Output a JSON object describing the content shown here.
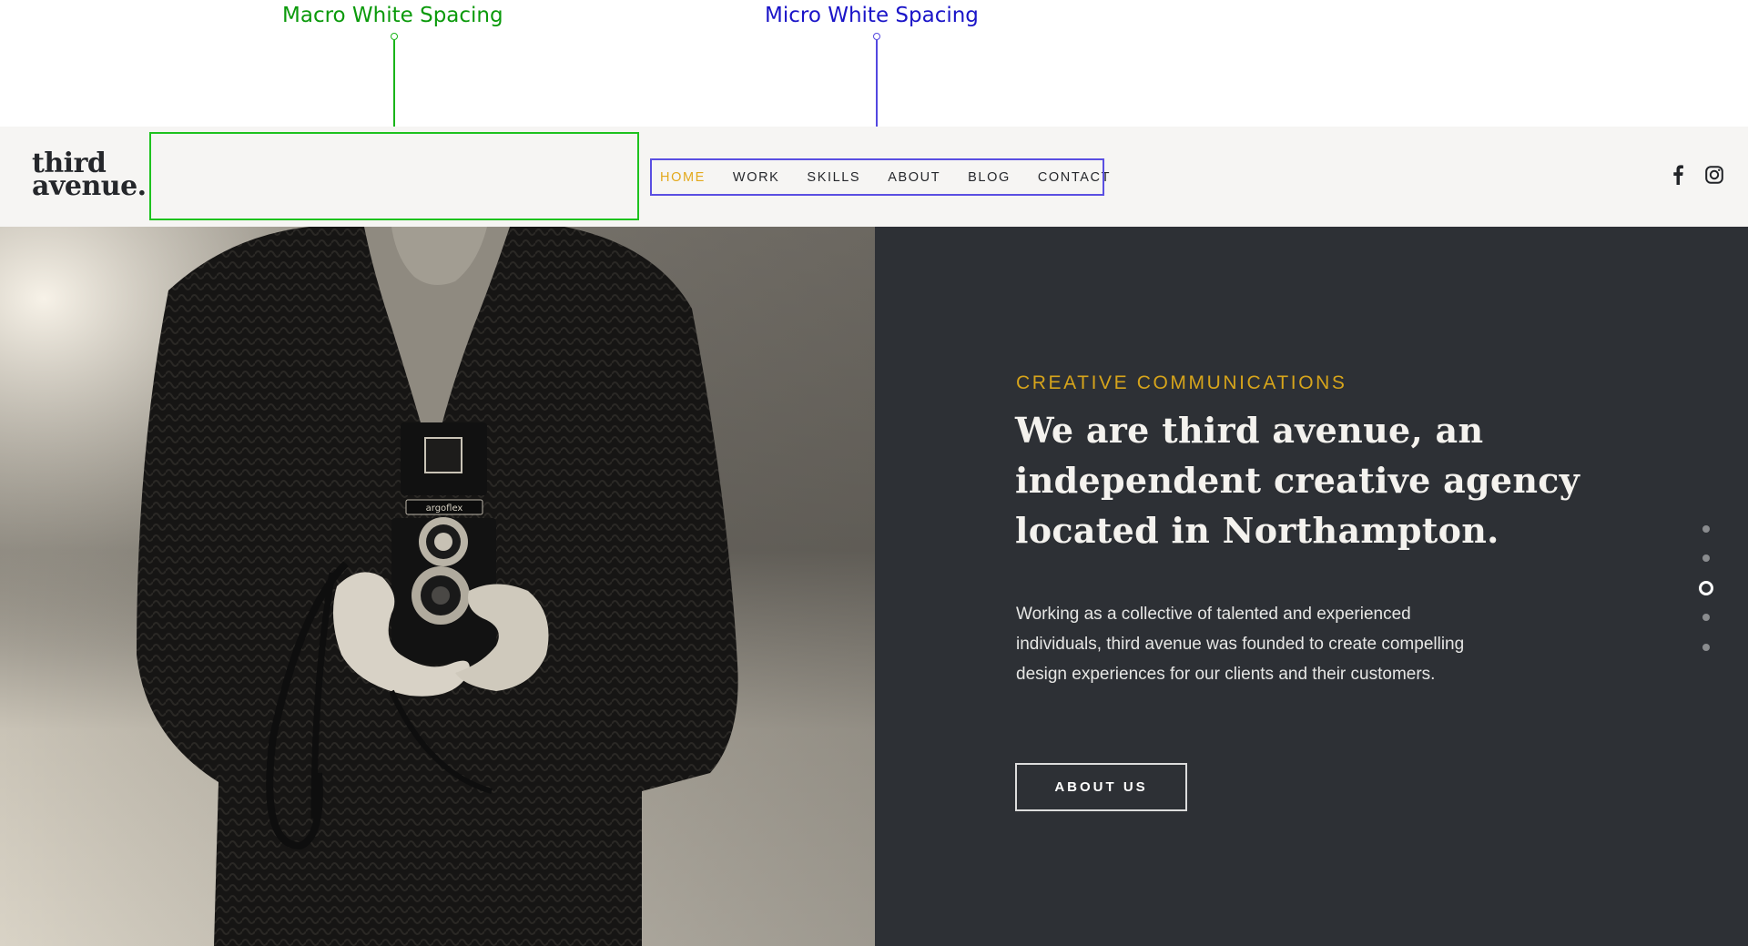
{
  "annotations": {
    "macro_label": "Macro White Spacing",
    "micro_label": "Micro White Spacing",
    "macro_color": "#0b9a0b",
    "micro_color": "#1a14c8"
  },
  "header": {
    "logo_line1": "third",
    "logo_line2": "avenue.",
    "nav": [
      {
        "label": "HOME",
        "active": true
      },
      {
        "label": "WORK",
        "active": false
      },
      {
        "label": "SKILLS",
        "active": false
      },
      {
        "label": "ABOUT",
        "active": false
      },
      {
        "label": "BLOG",
        "active": false
      },
      {
        "label": "CONTACT",
        "active": false
      }
    ],
    "social": [
      {
        "icon": "facebook-icon"
      },
      {
        "icon": "instagram-icon"
      }
    ],
    "accent_color": "#e3a91d"
  },
  "hero": {
    "photo_alt": "Person in a knit cardigan holding an Argoflex twin-lens camera",
    "camera_brand": "argoflex",
    "eyebrow": "CREATIVE COMMUNICATIONS",
    "headline_lines": [
      "We are third avenue, an",
      "independent creative agency",
      "located in Northampton."
    ],
    "body_lines": [
      "Working as a collective of talented and experienced",
      "individuals, third avenue was founded to create compelling",
      "design experiences for our clients and their customers."
    ],
    "cta_label": "ABOUT US",
    "slides": {
      "count": 5,
      "active_index": 3
    },
    "panel_color": "#2d3035"
  }
}
